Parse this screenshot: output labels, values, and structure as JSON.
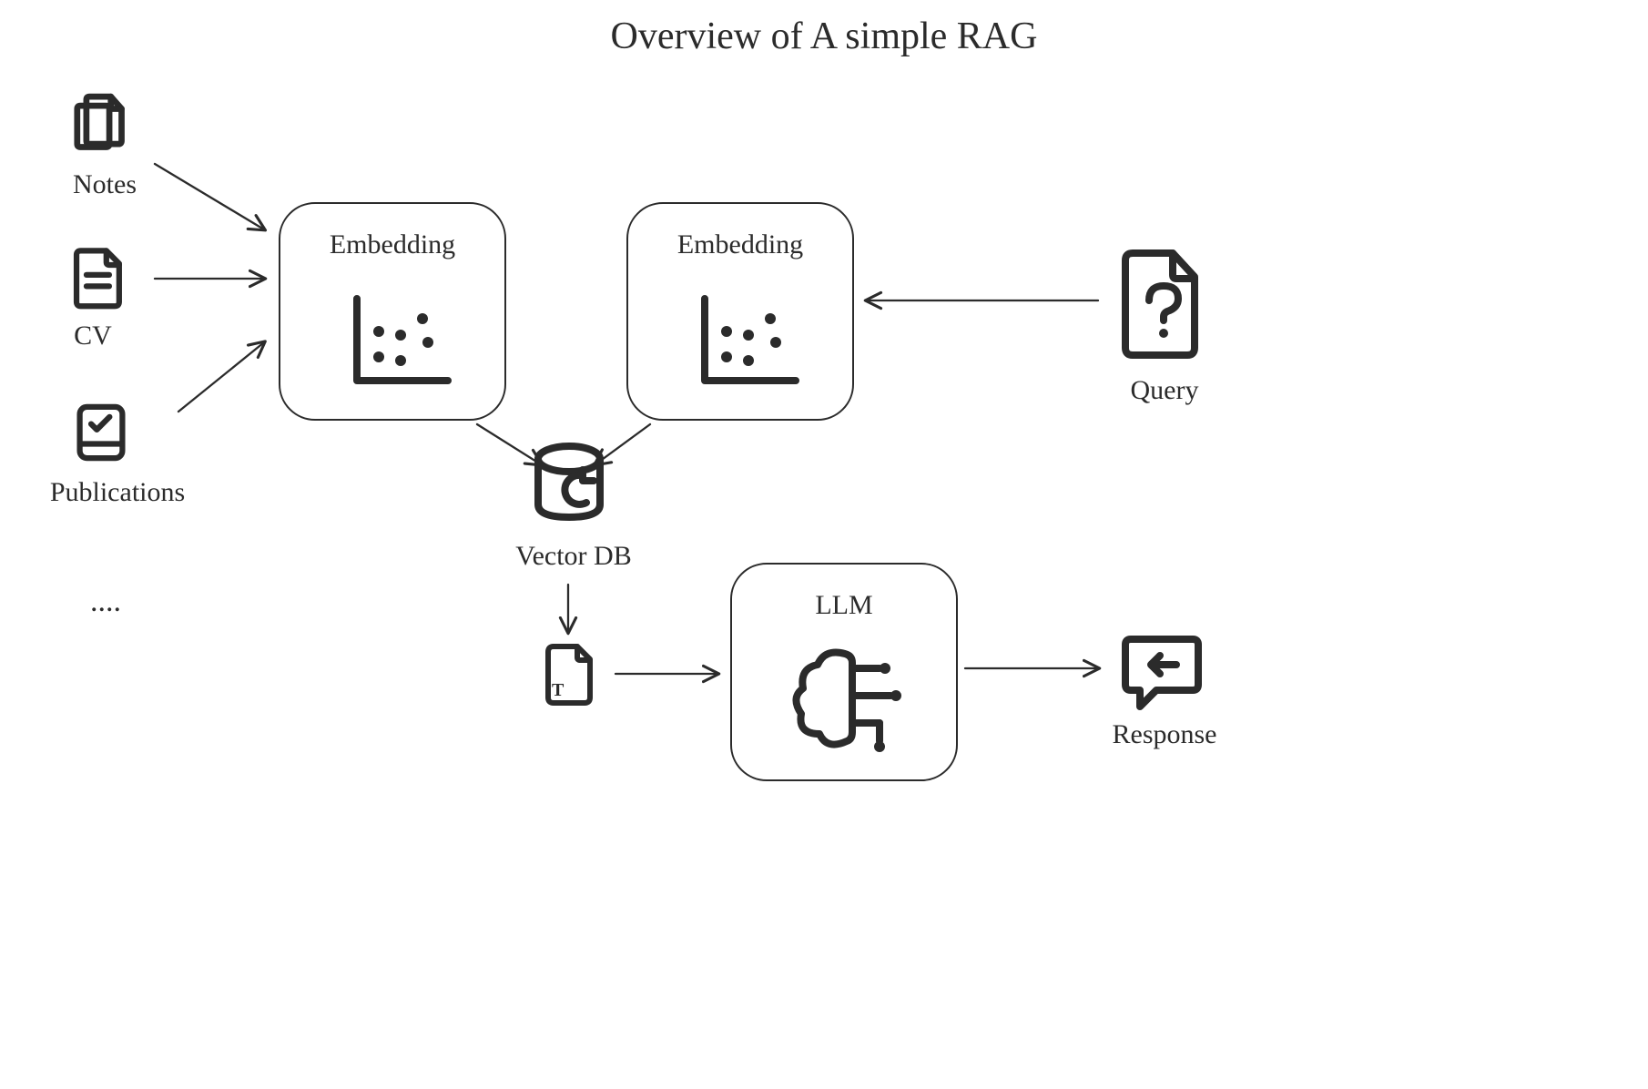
{
  "title": "Overview of A simple RAG",
  "sources": {
    "notes": "Notes",
    "cv": "CV",
    "publications": "Publications",
    "more": "...."
  },
  "embedding1": {
    "label": "Embedding"
  },
  "embedding2": {
    "label": "Embedding"
  },
  "vector_db": {
    "label": "Vector DB"
  },
  "query": {
    "label": "Query"
  },
  "llm": {
    "label": "LLM"
  },
  "response": {
    "label": "Response"
  }
}
